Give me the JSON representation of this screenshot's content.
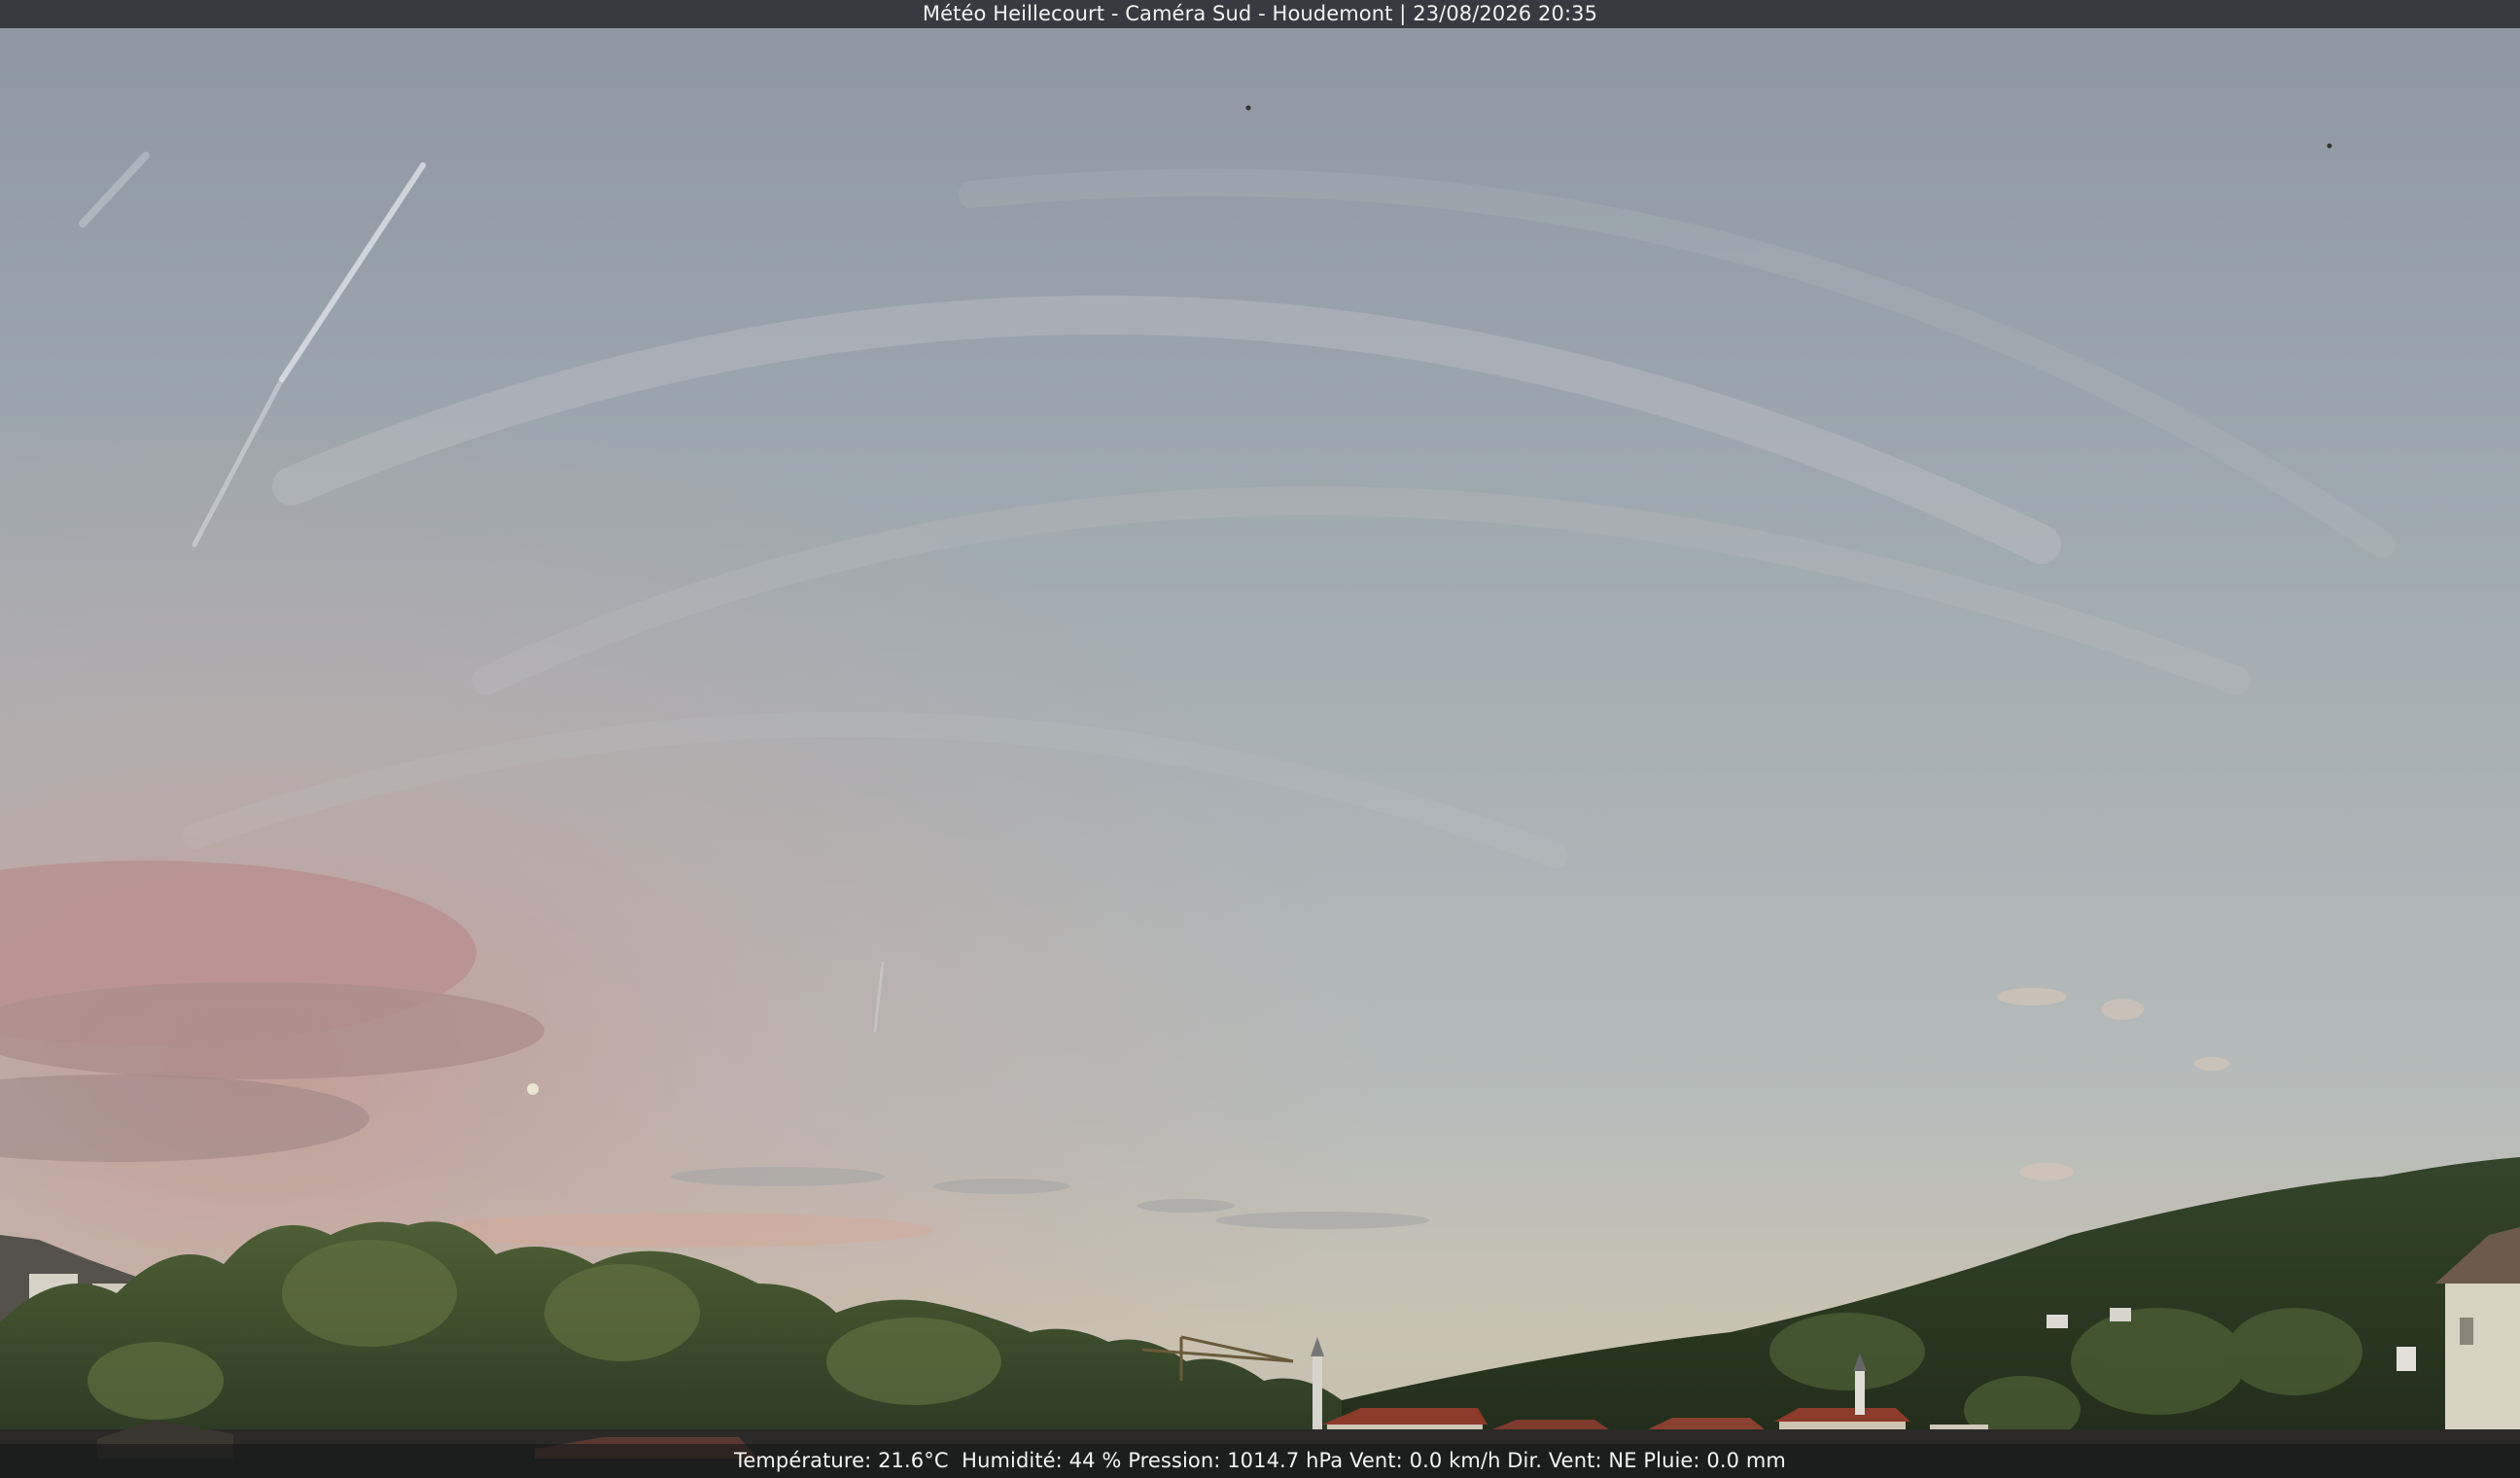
{
  "overlay": {
    "title": "Météo Heillecourt - Caméra Sud - Houdemont | 23/08/2026 20:35"
  },
  "weather": {
    "temperature_label": "Température:",
    "temperature_value": "21.6°C",
    "humidity_label": "Humidité:",
    "humidity_value": "44 %",
    "pressure_label": "Pression:",
    "pressure_value": "1014.7 hPa",
    "wind_label": "Vent:",
    "wind_value": "0.0 km/h",
    "wind_dir_label": "Dir. Vent:",
    "wind_dir_value": "NE",
    "rain_label": "Pluie:",
    "rain_value": "0.0 mm"
  },
  "colors": {
    "sky_top": "#8e97a2",
    "sky_mid": "#a9b3b8",
    "sky_horizon": "#c9c2b2",
    "sunset_pink": "#c9a09a",
    "vegetation_dark": "#2c3a22",
    "vegetation_light": "#55693a",
    "roof_red": "#8c3a2a"
  }
}
